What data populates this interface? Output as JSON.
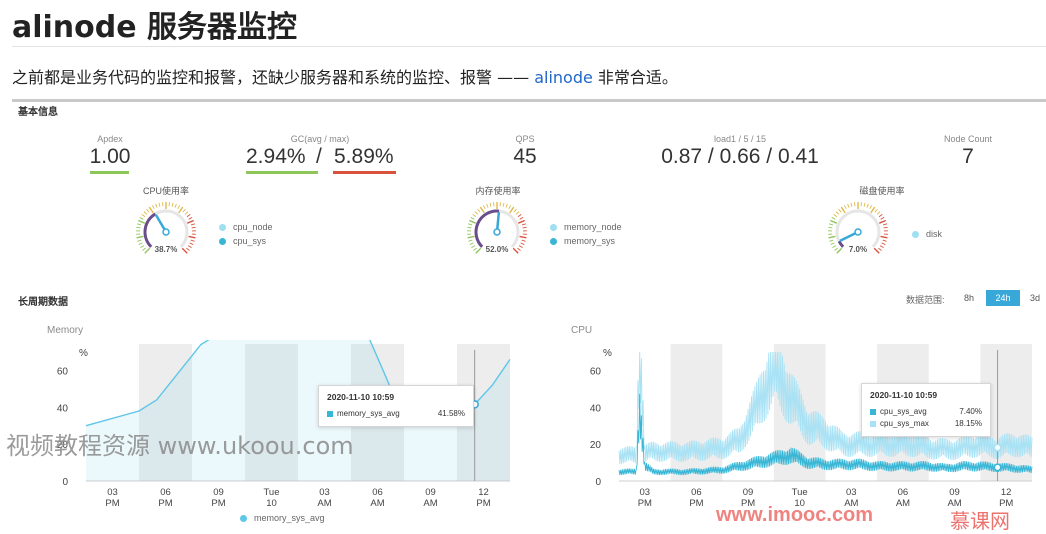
{
  "title": "alinode 服务器监控",
  "intro": {
    "before": "之前都是业务代码的监控和报警，还缺少服务器和系统的监控、报警 —— ",
    "link": "alinode",
    "after": " 非常合适。"
  },
  "basic": {
    "section_title": "基本信息",
    "metrics": [
      {
        "label": "Apdex",
        "value": "1.00"
      },
      {
        "label": "GC(avg / max)",
        "value_a": "2.94%",
        "sep": "/",
        "value_b": "5.89%"
      },
      {
        "label": "QPS",
        "value": "45"
      },
      {
        "label": "load1 / 5 / 15",
        "value": "0.87 / 0.66 / 0.41"
      },
      {
        "label": "Node Count",
        "value": "7"
      }
    ],
    "gauges": [
      {
        "title": "CPU使用率",
        "value_text": "38.7%",
        "fraction": 0.387,
        "legend": [
          "cpu_node",
          "cpu_sys"
        ]
      },
      {
        "title": "内存使用率",
        "value_text": "52.0%",
        "fraction": 0.52,
        "legend": [
          "memory_node",
          "memory_sys"
        ]
      },
      {
        "title": "磁盘使用率",
        "value_text": "7.0%",
        "fraction": 0.07,
        "legend": [
          "disk"
        ]
      }
    ]
  },
  "longterm": {
    "section_title": "长周期数据",
    "range_label": "数据范围:",
    "ranges": [
      "8h",
      "24h",
      "3d"
    ],
    "active_range": "24h"
  },
  "colors": {
    "accent": "#37a8d8",
    "green": "#8fc65a",
    "red": "#d9533c",
    "memory_line": "#5ec6e8",
    "cpu_line": "#7fd3ee",
    "band": "#ededed",
    "gauge_purple": "#6a4d8c"
  },
  "chart_data": [
    {
      "type": "area",
      "title": "Memory",
      "ylabel": "%",
      "ylim": [
        0,
        70
      ],
      "yticks": [
        "0",
        "20",
        "40",
        "60"
      ],
      "xticks": [
        [
          "03",
          "PM"
        ],
        [
          "06",
          "PM"
        ],
        [
          "09",
          "PM"
        ],
        [
          "Tue",
          "10"
        ],
        [
          "03",
          "AM"
        ],
        [
          "06",
          "AM"
        ],
        [
          "09",
          "AM"
        ],
        [
          "12",
          "PM"
        ]
      ],
      "series": [
        {
          "name": "memory_sys_avg",
          "x": [
            0,
            3,
            4,
            5,
            6,
            6.5,
            7,
            7.5,
            8,
            9,
            9.2,
            9.5,
            10,
            11,
            12,
            13,
            14,
            15,
            16,
            17,
            18,
            19,
            20,
            20.5,
            21,
            21.5,
            22,
            23,
            24
          ],
          "values": [
            30,
            38,
            44,
            56,
            68,
            74,
            77,
            78,
            78,
            78,
            78,
            78,
            78,
            78,
            78,
            78,
            78,
            78,
            78,
            56,
            33,
            30,
            31,
            33,
            35,
            38,
            41.58,
            52,
            66
          ]
        }
      ],
      "tooltip": {
        "time": "2020-11-10 10:59",
        "series": "memory_sys_avg",
        "value": "41.58%"
      },
      "legend": [
        "memory_sys_avg"
      ]
    },
    {
      "type": "line",
      "title": "CPU",
      "ylabel": "%",
      "ylim": [
        0,
        70
      ],
      "yticks": [
        "0",
        "20",
        "40",
        "60"
      ],
      "xticks": [
        [
          "03",
          "PM"
        ],
        [
          "06",
          "PM"
        ],
        [
          "09",
          "PM"
        ],
        [
          "Tue",
          "10"
        ],
        [
          "03",
          "AM"
        ],
        [
          "06",
          "AM"
        ],
        [
          "09",
          "AM"
        ],
        [
          "12",
          "PM"
        ]
      ],
      "series": [
        {
          "name": "cpu_sys_avg",
          "x": [
            0,
            1,
            1.2,
            1.5,
            2,
            4,
            6,
            7,
            8,
            9,
            10,
            11,
            12,
            13,
            14,
            15,
            16,
            17,
            18,
            19,
            20,
            21,
            22,
            23,
            24
          ],
          "values": [
            5,
            5,
            40,
            8,
            5,
            5,
            6,
            8,
            10,
            12,
            14,
            10,
            9,
            9,
            9,
            8,
            8,
            8,
            8,
            7,
            8,
            8,
            7.4,
            7,
            6
          ]
        },
        {
          "name": "cpu_sys_max",
          "x": [
            0,
            1,
            1.2,
            1.5,
            2,
            4,
            6,
            7,
            8,
            9,
            10,
            11,
            12,
            13,
            14,
            15,
            16,
            17,
            18,
            19,
            20,
            21,
            22,
            23,
            24
          ],
          "values": [
            14,
            14,
            75,
            15,
            16,
            16,
            18,
            22,
            40,
            62,
            45,
            30,
            26,
            20,
            20,
            20,
            20,
            20,
            18,
            17,
            18,
            20,
            18.15,
            20,
            18
          ]
        }
      ],
      "tooltip": {
        "time": "2020-11-10 10:59",
        "rows": [
          {
            "name": "cpu_sys_avg",
            "value": "7.40%"
          },
          {
            "name": "cpu_sys_max",
            "value": "18.15%"
          }
        ]
      }
    }
  ],
  "watermarks": [
    "视频教程资源 www.ukoou.com",
    "www.imooc.com",
    "慕课网"
  ]
}
